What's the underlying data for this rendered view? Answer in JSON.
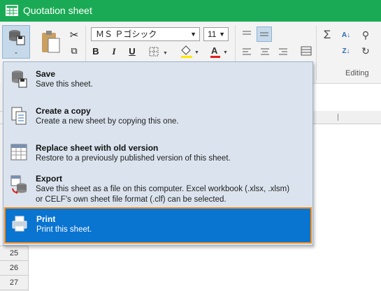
{
  "window": {
    "title": "Quotation sheet"
  },
  "ribbon": {
    "font_name": "ＭＳ Ｐゴシック",
    "font_size": "11",
    "bold": "B",
    "italic": "I",
    "underline": "U",
    "editing_label": "Editing"
  },
  "grid": {
    "row_numbers": [
      "25",
      "26",
      "27"
    ]
  },
  "menu": {
    "items": [
      {
        "label": "Save",
        "description": "Save this sheet.",
        "icon": "database-save-icon"
      },
      {
        "label": "Create a copy",
        "description": "Create a new sheet by copying this one.",
        "icon": "copy-document-icon"
      },
      {
        "label": "Replace sheet with old version",
        "description": "Restore to a previously published version of this sheet.",
        "icon": "replace-sheet-icon"
      },
      {
        "label": "Export",
        "description": "Save this sheet as a file on this computer. Excel workbook (.xlsx, .xlsm)",
        "description2": "or CELF's own sheet file format (.clf) can be selected.",
        "icon": "export-icon"
      },
      {
        "label": "Print",
        "description": "Print this sheet.",
        "icon": "printer-icon",
        "highlighted": true
      }
    ]
  },
  "colors": {
    "titlebar": "#1aaa55",
    "highlight": "#0a74d1",
    "highlight_border": "#f28b1a",
    "menu_bg": "#dbe4ee"
  }
}
